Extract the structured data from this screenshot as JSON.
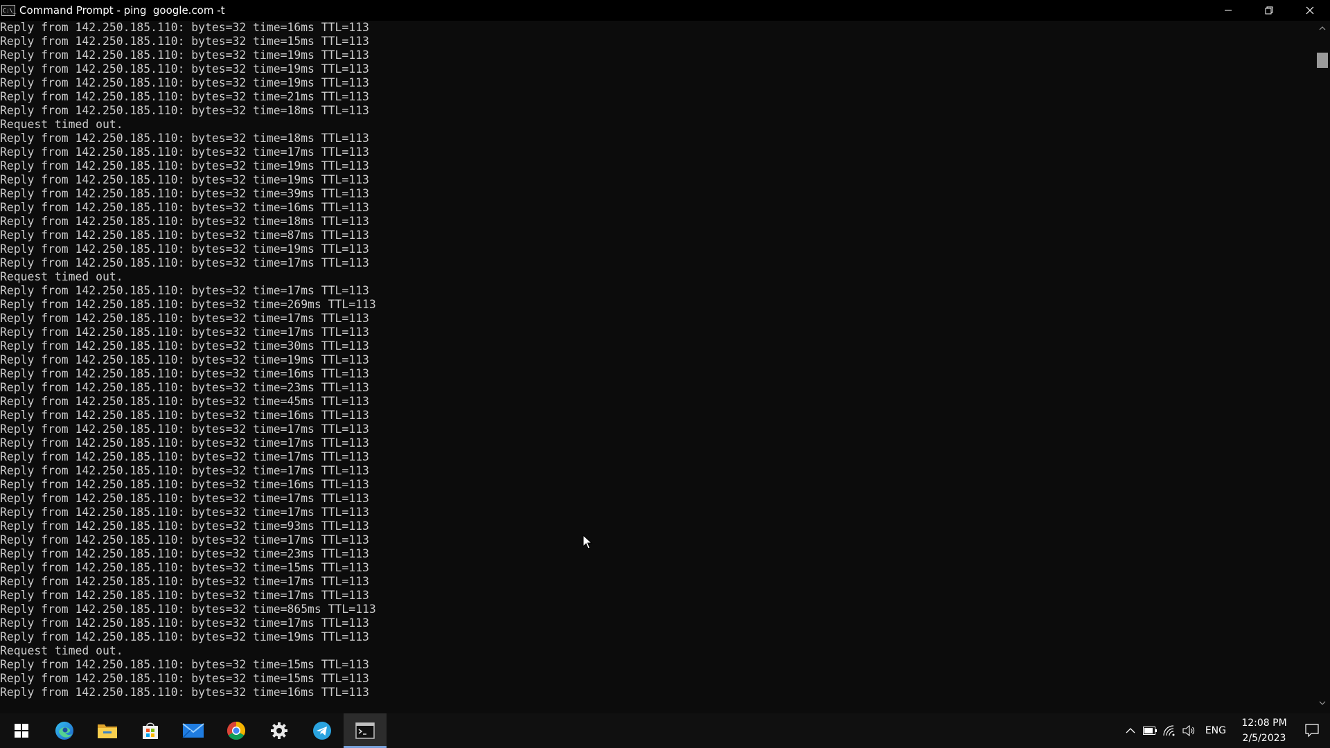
{
  "window": {
    "title": "Command Prompt - ping  google.com -t",
    "icon": "cmd-icon",
    "icon_text": "C:\\_",
    "controls": [
      "minimize-icon",
      "restore-icon",
      "close-icon"
    ]
  },
  "console": {
    "lines": [
      "Reply from 142.250.185.110: bytes=32 time=16ms TTL=113",
      "Reply from 142.250.185.110: bytes=32 time=15ms TTL=113",
      "Reply from 142.250.185.110: bytes=32 time=19ms TTL=113",
      "Reply from 142.250.185.110: bytes=32 time=19ms TTL=113",
      "Reply from 142.250.185.110: bytes=32 time=19ms TTL=113",
      "Reply from 142.250.185.110: bytes=32 time=21ms TTL=113",
      "Reply from 142.250.185.110: bytes=32 time=18ms TTL=113",
      "Request timed out.",
      "Reply from 142.250.185.110: bytes=32 time=18ms TTL=113",
      "Reply from 142.250.185.110: bytes=32 time=17ms TTL=113",
      "Reply from 142.250.185.110: bytes=32 time=19ms TTL=113",
      "Reply from 142.250.185.110: bytes=32 time=19ms TTL=113",
      "Reply from 142.250.185.110: bytes=32 time=39ms TTL=113",
      "Reply from 142.250.185.110: bytes=32 time=16ms TTL=113",
      "Reply from 142.250.185.110: bytes=32 time=18ms TTL=113",
      "Reply from 142.250.185.110: bytes=32 time=87ms TTL=113",
      "Reply from 142.250.185.110: bytes=32 time=19ms TTL=113",
      "Reply from 142.250.185.110: bytes=32 time=17ms TTL=113",
      "Request timed out.",
      "Reply from 142.250.185.110: bytes=32 time=17ms TTL=113",
      "Reply from 142.250.185.110: bytes=32 time=269ms TTL=113",
      "Reply from 142.250.185.110: bytes=32 time=17ms TTL=113",
      "Reply from 142.250.185.110: bytes=32 time=17ms TTL=113",
      "Reply from 142.250.185.110: bytes=32 time=30ms TTL=113",
      "Reply from 142.250.185.110: bytes=32 time=19ms TTL=113",
      "Reply from 142.250.185.110: bytes=32 time=16ms TTL=113",
      "Reply from 142.250.185.110: bytes=32 time=23ms TTL=113",
      "Reply from 142.250.185.110: bytes=32 time=45ms TTL=113",
      "Reply from 142.250.185.110: bytes=32 time=16ms TTL=113",
      "Reply from 142.250.185.110: bytes=32 time=17ms TTL=113",
      "Reply from 142.250.185.110: bytes=32 time=17ms TTL=113",
      "Reply from 142.250.185.110: bytes=32 time=17ms TTL=113",
      "Reply from 142.250.185.110: bytes=32 time=17ms TTL=113",
      "Reply from 142.250.185.110: bytes=32 time=16ms TTL=113",
      "Reply from 142.250.185.110: bytes=32 time=17ms TTL=113",
      "Reply from 142.250.185.110: bytes=32 time=17ms TTL=113",
      "Reply from 142.250.185.110: bytes=32 time=93ms TTL=113",
      "Reply from 142.250.185.110: bytes=32 time=17ms TTL=113",
      "Reply from 142.250.185.110: bytes=32 time=23ms TTL=113",
      "Reply from 142.250.185.110: bytes=32 time=15ms TTL=113",
      "Reply from 142.250.185.110: bytes=32 time=17ms TTL=113",
      "Reply from 142.250.185.110: bytes=32 time=17ms TTL=113",
      "Reply from 142.250.185.110: bytes=32 time=865ms TTL=113",
      "Reply from 142.250.185.110: bytes=32 time=17ms TTL=113",
      "Reply from 142.250.185.110: bytes=32 time=19ms TTL=113",
      "Request timed out.",
      "Reply from 142.250.185.110: bytes=32 time=15ms TTL=113",
      "Reply from 142.250.185.110: bytes=32 time=15ms TTL=113",
      "Reply from 142.250.185.110: bytes=32 time=16ms TTL=113"
    ]
  },
  "scrollbar": {
    "icons": [
      "scroll-up-arrow-icon",
      "scroll-down-arrow-icon"
    ]
  },
  "taskbar": {
    "apps": [
      {
        "name": "start",
        "icon": "windows-start-icon",
        "active": false
      },
      {
        "name": "edge",
        "icon": "edge-browser-icon",
        "active": false
      },
      {
        "name": "file-explorer",
        "icon": "folder-icon",
        "active": false
      },
      {
        "name": "store",
        "icon": "store-bag-icon",
        "active": false
      },
      {
        "name": "mail",
        "icon": "mail-envelope-icon",
        "active": false
      },
      {
        "name": "chrome",
        "icon": "chrome-icon",
        "active": false
      },
      {
        "name": "settings",
        "icon": "gear-icon",
        "active": false
      },
      {
        "name": "telegram",
        "icon": "telegram-icon",
        "active": false
      },
      {
        "name": "command-prompt",
        "icon": "cmd-icon",
        "active": true
      }
    ],
    "tray": {
      "icons": [
        "chevron-up-icon",
        "battery-icon",
        "wifi-icon",
        "speaker-icon"
      ],
      "language": "ENG",
      "time": "12:08 PM",
      "date": "2/5/2023",
      "notification_icon": "notification-icon"
    },
    "colors": {
      "active_indicator": "#78a0d8",
      "background": "#101010"
    }
  },
  "colors": {
    "console_bg": "#0c0c0c",
    "console_fg": "#cccccc",
    "titlebar_bg": "#000000"
  }
}
